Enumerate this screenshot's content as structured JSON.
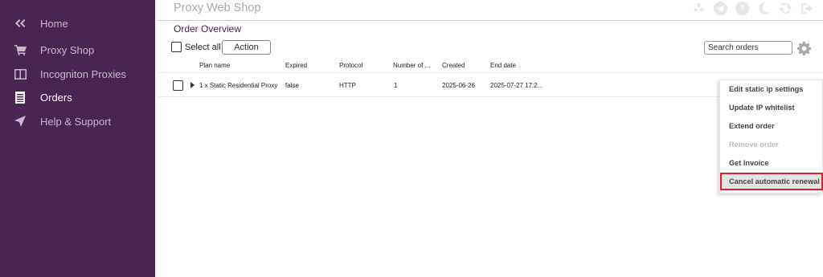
{
  "app": {
    "title": "Proxy Web Shop"
  },
  "sidebar": {
    "items": [
      {
        "label": "Home",
        "icon": "collapse-icon",
        "active": false
      },
      {
        "label": "Proxy Shop",
        "icon": "cart-icon",
        "active": false
      },
      {
        "label": "Incogniton Proxies",
        "icon": "window-icon",
        "active": false
      },
      {
        "label": "Orders",
        "icon": "receipt-icon",
        "active": true
      },
      {
        "label": "Help & Support",
        "icon": "send-icon",
        "active": false
      }
    ]
  },
  "header": {
    "icons": [
      "recycle-icon",
      "telegram-icon",
      "help-icon",
      "moon-icon",
      "refresh-icon",
      "logout-icon"
    ]
  },
  "orders": {
    "title": "Order Overview",
    "select_all_label": "Select all",
    "action_label": "Action",
    "search_placeholder": "Search orders",
    "columns": [
      "Plan name",
      "Expired",
      "Protocol",
      "Number of ...",
      "Created",
      "End date"
    ],
    "rows": [
      {
        "plan": "1 x Static Residential Proxy",
        "expired": "false",
        "protocol": "HTTP",
        "number": "1",
        "created": "2025-06-26",
        "end": "2025-07-27 17:2..."
      }
    ]
  },
  "context_menu": {
    "items": [
      {
        "label": "Edit static ip settings",
        "disabled": false
      },
      {
        "label": "Update IP whitelist",
        "disabled": false
      },
      {
        "label": "Extend order",
        "disabled": false
      },
      {
        "label": "Remove order",
        "disabled": true
      },
      {
        "label": "Get Invoice",
        "disabled": false
      },
      {
        "label": "Cancel automatic renewal",
        "disabled": false,
        "highlighted": true
      }
    ]
  },
  "colors": {
    "sidebar_bg": "#4a2452",
    "accent": "#4a2452",
    "highlight_border": "#d9232d"
  }
}
